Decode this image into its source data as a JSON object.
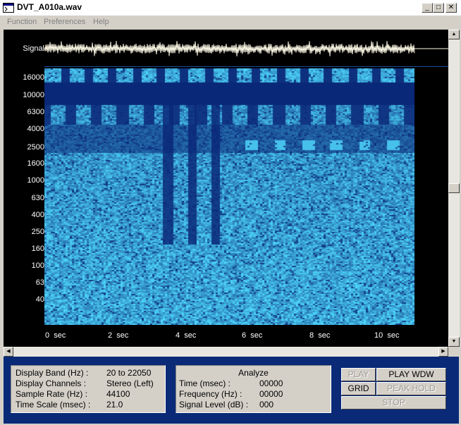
{
  "window": {
    "title": "DVT_A010a.wav",
    "minimize_label": "_",
    "maximize_label": "□",
    "close_label": "✕"
  },
  "menu": [
    {
      "label": "Function"
    },
    {
      "label": "Preferences"
    },
    {
      "label": "Help"
    }
  ],
  "display": {
    "signal_label": "Signal",
    "frequency_labels": [
      "16000",
      "10000",
      "6300",
      "4000",
      "2500",
      "1600",
      "1000",
      "630",
      "400",
      "250",
      "160",
      "100",
      "63",
      "40"
    ],
    "time_labels": [
      "0  sec",
      "2  sec",
      "4  sec",
      "6  sec",
      "8  sec",
      "10  sec"
    ],
    "colors": {
      "background": "#000000",
      "spectrogram_low": "#0a3a9c",
      "spectrogram_high": "#4fd8ff",
      "signal": "#fffbe8"
    }
  },
  "info_panel": {
    "display_band_label": "Display Band (Hz) :",
    "display_band_value": "20 to 22050",
    "display_channels_label": "Display Channels :",
    "display_channels_value": "Stereo (Left)",
    "sample_rate_label": "Sample Rate (Hz) :",
    "sample_rate_value": "44100",
    "time_scale_label": "Time Scale (msec) :",
    "time_scale_value": "21.0"
  },
  "analyze_panel": {
    "title": "Analyze",
    "time_label": "Time (msec) :",
    "time_value": "00000",
    "frequency_label": "Frequency (Hz) :",
    "frequency_value": "00000",
    "signal_level_label": "Signal Level (dB) :",
    "signal_level_value": "000"
  },
  "controls": {
    "play": "PLAY",
    "play_wdw": "PLAY WDW",
    "grid": "GRID",
    "peak_hold": "PEAK HOLD",
    "stop": "STOP"
  }
}
